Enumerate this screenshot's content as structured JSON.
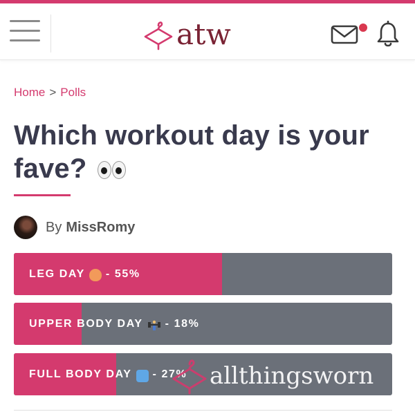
{
  "header": {
    "logo_text": "atw",
    "icons": [
      "menu-icon",
      "hanger-icon",
      "mail-icon",
      "bell-icon"
    ],
    "notification_dot_color": "#d9384f"
  },
  "breadcrumb": {
    "home": "Home",
    "separator": ">",
    "current": "Polls"
  },
  "poll": {
    "title": "Which workout day is your fave?",
    "author_prefix": "By",
    "author": "MissRomy",
    "options": [
      {
        "label": "LEG DAY",
        "emoji": "peach-emoji",
        "suffix": "- 55%",
        "percent": 55
      },
      {
        "label": "UPPER BODY DAY",
        "emoji": "weightlifter-emoji",
        "suffix": "- 18%",
        "percent": 18
      },
      {
        "label": "FULL BODY DAY",
        "emoji": "cycle-emoji",
        "suffix": "- 27%",
        "percent": 27
      }
    ]
  },
  "watermark": {
    "text": "allthingsworn"
  },
  "colors": {
    "accent": "#d43a6e",
    "logo_text": "#7a2334",
    "bar_track": "#6b7079",
    "title": "#393a4d"
  }
}
